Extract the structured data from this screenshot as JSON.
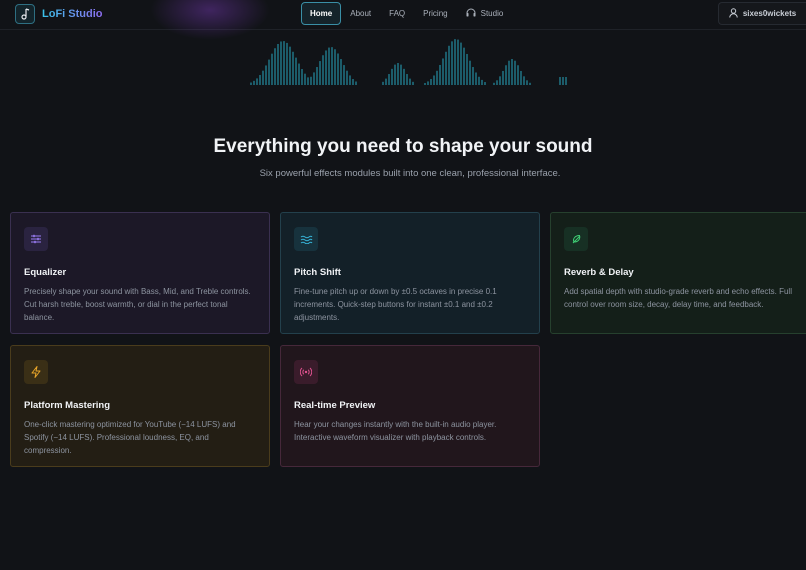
{
  "navbar": {
    "brand": "LoFi Studio",
    "items": [
      {
        "label": "Home",
        "active": true
      },
      {
        "label": "About"
      },
      {
        "label": "FAQ"
      },
      {
        "label": "Pricing"
      },
      {
        "label": "Studio",
        "icon": "headphones-icon"
      }
    ],
    "user": {
      "name": "sixes0wickets",
      "icon": "user-icon"
    }
  },
  "hero": {
    "title": "Everything you need to shape your sound",
    "subtitle": "Six powerful effects modules built into one clean, professional interface."
  },
  "features": [
    {
      "title": "Equalizer",
      "icon": "sliders-icon",
      "color": "#8d6df0",
      "description": "Precisely shape your sound with Bass, Mid, and Treble controls. Cut harsh treble, boost warmth, or dial in the perfect tonal balance."
    },
    {
      "title": "Pitch Shift",
      "icon": "waves-icon",
      "color": "#38b8dd",
      "description": "Fine-tune pitch up or down by ±0.5 octaves in precise 0.1 increments. Quick-step buttons for instant ±0.1 and ±0.2 adjustments."
    },
    {
      "title": "Reverb & Delay",
      "icon": "feather-icon",
      "color": "#3fcf75",
      "description": "Add spatial depth with studio-grade reverb and echo effects. Full control over room size, decay, delay time, and feedback."
    },
    {
      "title": "Platform Mastering",
      "icon": "lightning-icon",
      "color": "#e8a52a",
      "description": "One-click mastering optimized for YouTube (−14 LUFS) and Spotify (−14 LUFS). Professional loudness, EQ, and compression."
    },
    {
      "title": "Real-time Preview",
      "icon": "broadcast-icon",
      "color": "#e0528f",
      "description": "Hear your changes instantly with the built-in audio player. Interactive waveform visualizer with playback controls."
    }
  ],
  "colors": {
    "background": "#111317",
    "accent_cyan": "#38c2e8",
    "accent_purple": "#8d6df0",
    "waveform": "#1f6f80"
  }
}
